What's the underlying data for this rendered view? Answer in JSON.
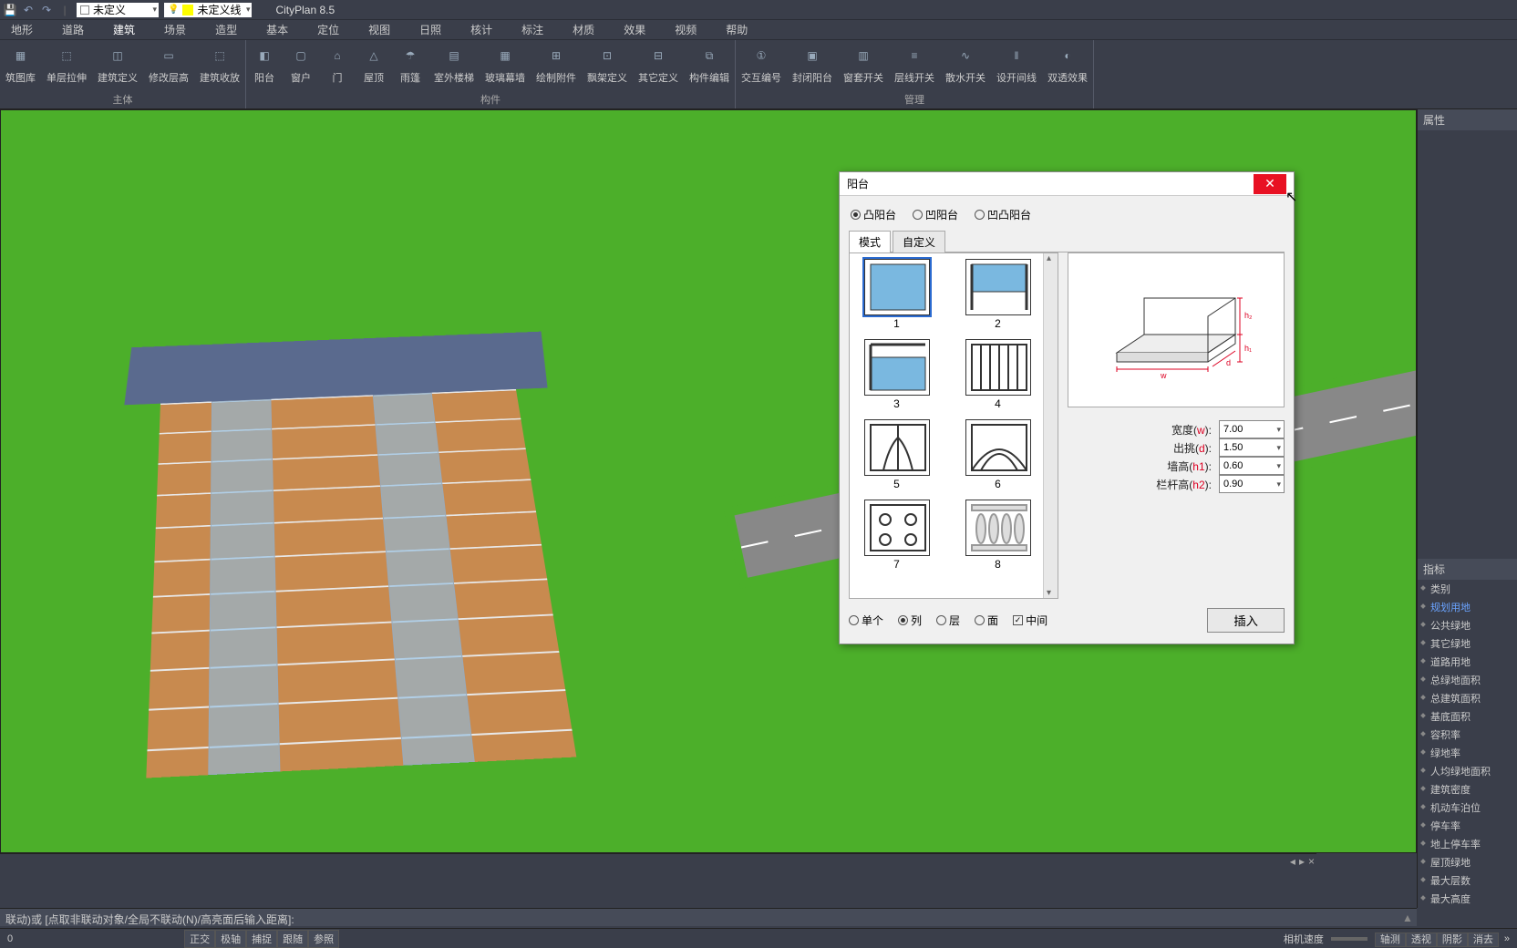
{
  "app": {
    "title": "CityPlan 8.5",
    "layer_undef": "未定义",
    "layer_line": "未定义线"
  },
  "menu": [
    "地形",
    "道路",
    "建筑",
    "场景",
    "造型",
    "基本",
    "定位",
    "视图",
    "日照",
    "核计",
    "标注",
    "材质",
    "效果",
    "视频",
    "帮助"
  ],
  "menu_active": 2,
  "ribbon": {
    "groups": [
      {
        "label": "主体",
        "items": [
          "筑图库",
          "单层拉伸",
          "建筑定义",
          "修改层高",
          "建筑收放"
        ]
      },
      {
        "label": "构件",
        "items": [
          "阳台",
          "窗户",
          "门",
          "屋顶",
          "雨篷",
          "室外楼梯",
          "玻璃幕墙",
          "绘制附件",
          "飘架定义",
          "其它定义",
          "构件编辑"
        ]
      },
      {
        "label": "管理",
        "items": [
          "交互编号",
          "封闭阳台",
          "窗套开关",
          "层线开关",
          "散水开关",
          "设开间线",
          "双透效果"
        ]
      }
    ]
  },
  "dialog": {
    "title": "阳台",
    "radios_top": [
      {
        "label": "凸阳台",
        "sel": true
      },
      {
        "label": "凹阳台",
        "sel": false
      },
      {
        "label": "凹凸阳台",
        "sel": false
      }
    ],
    "tabs": [
      {
        "label": "模式",
        "active": true
      },
      {
        "label": "自定义",
        "active": false
      }
    ],
    "thumbs": [
      "1",
      "2",
      "3",
      "4",
      "5",
      "6",
      "7",
      "8"
    ],
    "thumb_selected": 0,
    "params": [
      {
        "label": "宽度",
        "var": "w",
        "value": "7.00"
      },
      {
        "label": "出挑",
        "var": "d",
        "value": "1.50"
      },
      {
        "label": "墙高",
        "var": "h1",
        "value": "0.60"
      },
      {
        "label": "栏杆高",
        "var": "h2",
        "value": "0.90"
      }
    ],
    "radios_bottom": [
      {
        "label": "单个",
        "sel": false
      },
      {
        "label": "列",
        "sel": true
      },
      {
        "label": "层",
        "sel": false
      },
      {
        "label": "面",
        "sel": false
      }
    ],
    "check_mid": {
      "label": "中间",
      "checked": true
    },
    "insert": "插入"
  },
  "props": {
    "title": "属性"
  },
  "indicators": {
    "title": "指标",
    "items": [
      "类别",
      "规划用地",
      "公共绿地",
      "其它绿地",
      "道路用地",
      "总绿地面积",
      "总建筑面积",
      "基底面积",
      "容积率",
      "绿地率",
      "人均绿地面积",
      "建筑密度",
      "机动车泊位",
      "停车率",
      "地上停车率",
      "屋顶绿地",
      "最大层数",
      "最大高度"
    ],
    "highlight": 1
  },
  "cmd": {
    "hint": "联动)或 [点取非联动对象/全局不联动(N)/高亮面后输入距离]:"
  },
  "status": {
    "left_num": "0",
    "toggles": [
      "正交",
      "极轴",
      "捕捉",
      "跟随",
      "参照"
    ],
    "camera_label": "相机速度",
    "right_btns": [
      "轴测",
      "透视",
      "阴影",
      "消去"
    ]
  }
}
